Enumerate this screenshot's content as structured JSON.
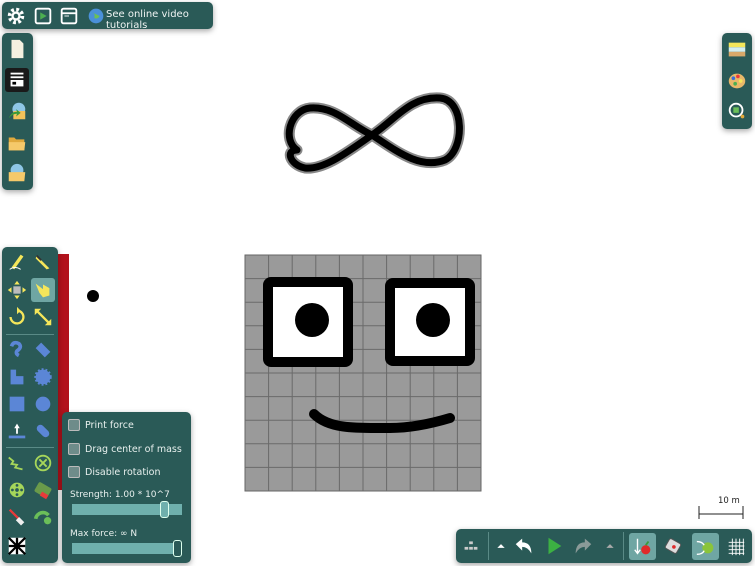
{
  "topbar": {
    "settings_icon": "gear-icon",
    "play_icon": "play-window-icon",
    "window_icon": "window-icon",
    "tutorials_label": "See online video tutorials"
  },
  "filebar": {
    "items": [
      "new-scene-icon",
      "browser-icon",
      "share-icon",
      "open-folder-icon",
      "open-scene-icon"
    ]
  },
  "rightbar": {
    "items": [
      "background-icon",
      "palette-icon",
      "zoom-icon"
    ]
  },
  "options": {
    "print_force": "Print force",
    "drag_center": "Drag center of mass",
    "disable_rotation": "Disable rotation",
    "strength_label": "Strength:  1.00 * 10^7",
    "strength_value": 0.87,
    "max_force_label": "Max force:  ∞  N",
    "max_force_value": 1.0
  },
  "scale": {
    "label": "10 m"
  },
  "colors": {
    "panel": "#2a5a57",
    "accent": "#6fa6a3",
    "box": "#9a9a9a",
    "red": "#b2121c"
  }
}
